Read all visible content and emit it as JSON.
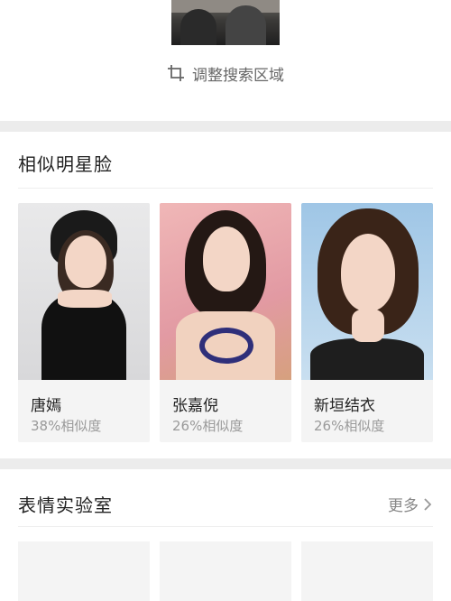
{
  "crop": {
    "adjust_label": "调整搜索区域"
  },
  "similar_stars": {
    "title": "相似明星脸",
    "items": [
      {
        "name": "唐嫣",
        "similarity": "38%相似度"
      },
      {
        "name": "张嘉倪",
        "similarity": "26%相似度"
      },
      {
        "name": "新垣结衣",
        "similarity": "26%相似度"
      }
    ]
  },
  "expression_lab": {
    "title": "表情实验室",
    "more_label": "更多"
  },
  "colors": {
    "page_bg": "#ececec",
    "card_bg": "#ffffff",
    "tile_bg": "#f4f4f4",
    "text_primary": "#222222",
    "text_secondary": "#9a9a9a"
  }
}
